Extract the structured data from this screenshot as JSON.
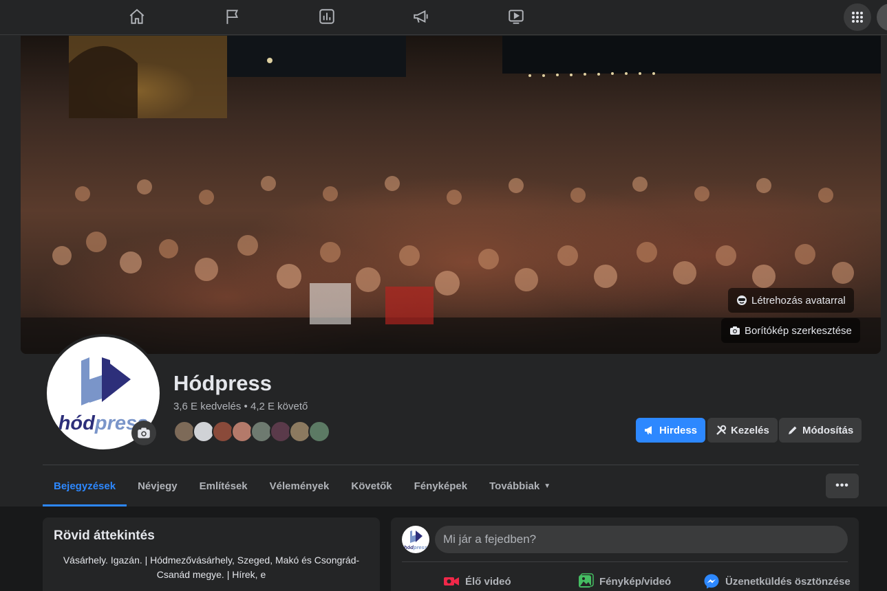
{
  "page": {
    "name": "Hódpress",
    "stats": "3,6 E kedvelés • 4,2 E követő"
  },
  "colors": {
    "accent": "#2d88ff",
    "background": "#18191a",
    "surface": "#242526",
    "button": "#3a3b3c"
  },
  "topnav": {
    "icons": [
      "home-icon",
      "flag-icon",
      "insights-icon",
      "megaphone-icon",
      "video-icon",
      "menu-grid-icon"
    ]
  },
  "cover": {
    "avatar_button": "Létrehozás avatarral",
    "edit_button": "Borítókép szerkesztése"
  },
  "actions": {
    "advertise": "Hirdess",
    "manage": "Kezelés",
    "edit": "Módosítás"
  },
  "tabs": [
    {
      "label": "Bejegyzések",
      "active": true
    },
    {
      "label": "Névjegy"
    },
    {
      "label": "Említések"
    },
    {
      "label": "Vélemények"
    },
    {
      "label": "Követők"
    },
    {
      "label": "Fényképek"
    },
    {
      "label": "Továbbiak"
    }
  ],
  "more_button": "•••",
  "intro": {
    "title": "Rövid áttekintés",
    "text": "Vásárhely. Igazán. | Hódmezővásárhely, Szeged, Makó és Csongrád-Csanád megye. | Hírek, e"
  },
  "composer": {
    "placeholder": "Mi jár a fejedben?",
    "live_video": "Élő videó",
    "photo_video": "Fénykép/videó",
    "messaging": "Üzenetküldés ösztönzése"
  },
  "logo_text": "hódpress"
}
